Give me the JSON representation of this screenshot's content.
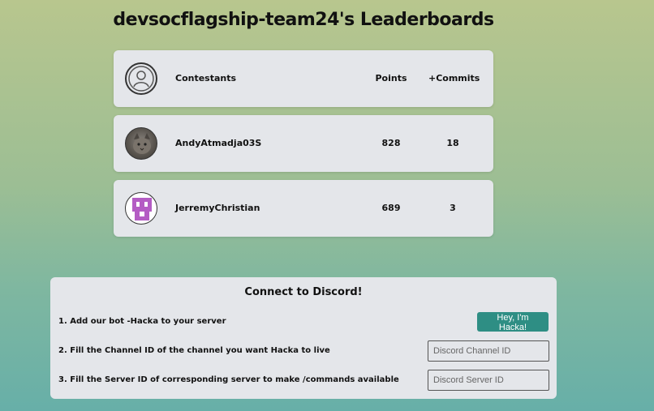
{
  "page": {
    "title": "devsocflagship-team24's Leaderboards"
  },
  "leaderboard": {
    "header": {
      "contestants_label": "Contestants",
      "points_label": "Points",
      "commits_label": "+Commits",
      "icon": "user-circle-icon"
    },
    "rows": [
      {
        "name": "AndyAtmadja03S",
        "points": "828",
        "commits": "18",
        "avatar": "cat-photo"
      },
      {
        "name": "JerremyChristian",
        "points": "689",
        "commits": "3",
        "avatar": "pixel-identicon"
      }
    ]
  },
  "discord": {
    "title": "Connect to Discord!",
    "step1": "1. Add our bot -Hacka to your server",
    "step2": "2. Fill the Channel ID of the channel you want Hacka to live",
    "step3": "3. Fill the Server ID of corresponding server to make /commands available",
    "button_label": "Hey, I'm Hacka!",
    "channel_placeholder": "Discord Channel ID",
    "server_placeholder": "Discord Server ID",
    "button_color": "#2e8e84"
  }
}
